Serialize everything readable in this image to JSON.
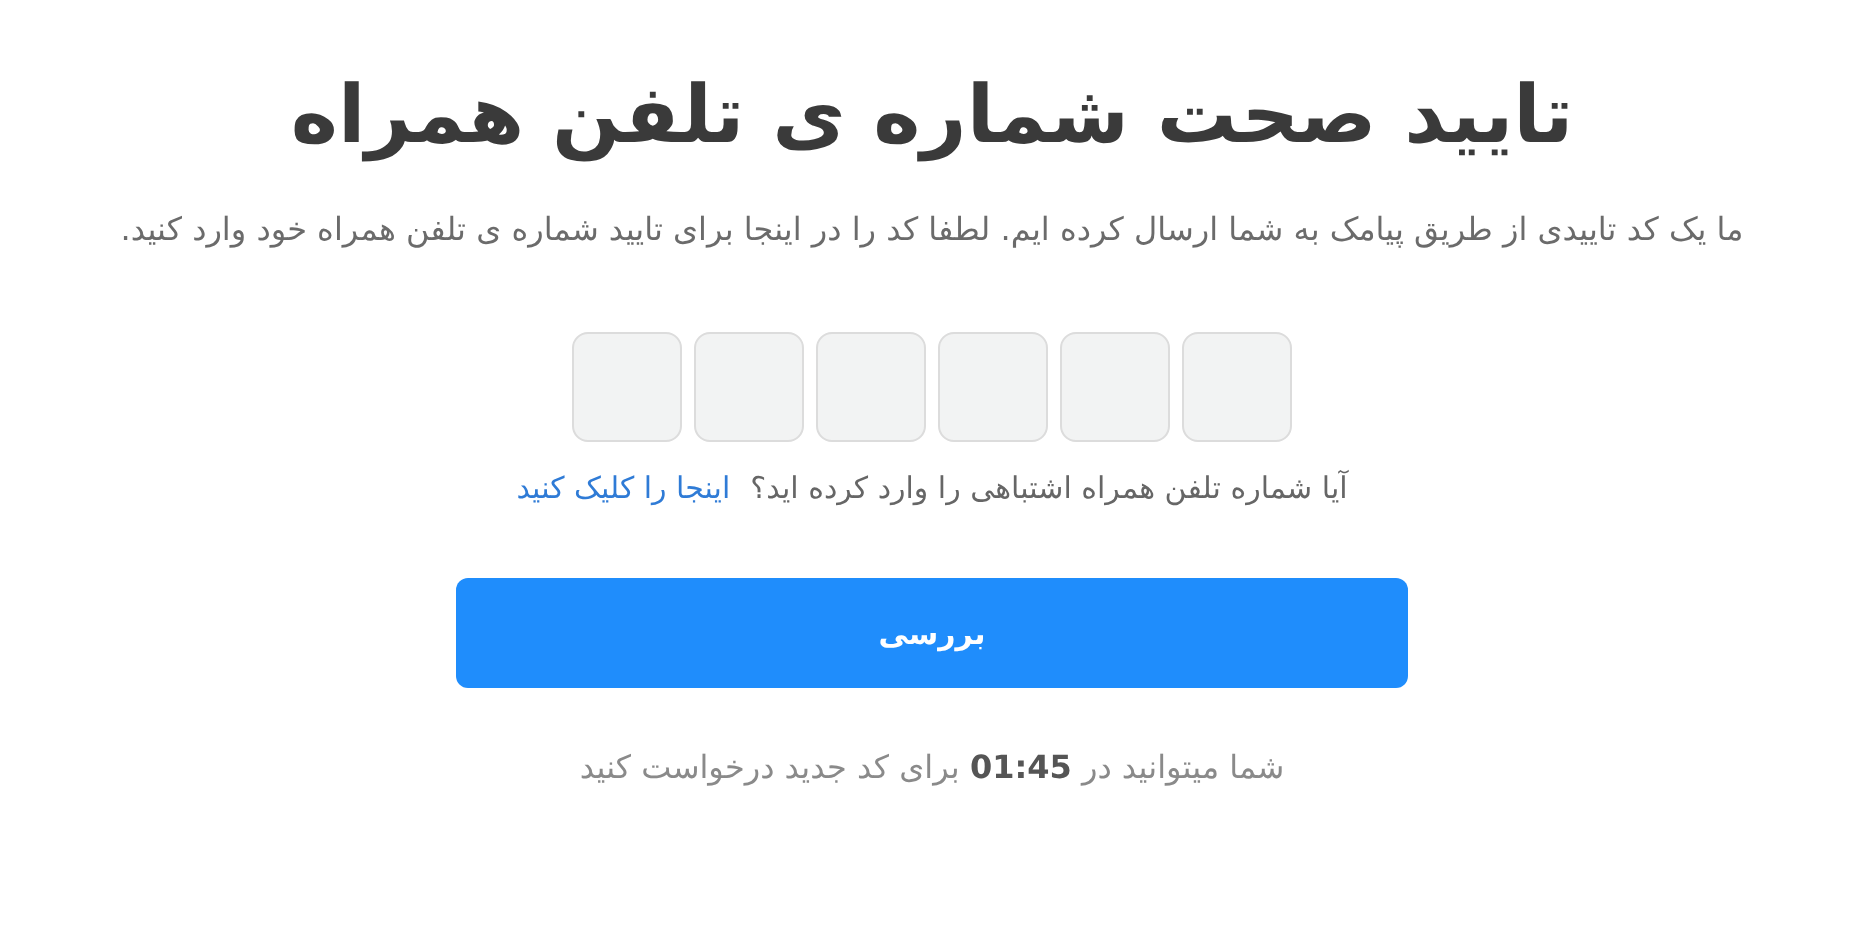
{
  "title": "تایید صحت شماره ی تلفن همراه",
  "description": "ما یک کد تاییدی از طریق پیامک به شما ارسال کرده ایم. لطفا کد را در اینجا برای تایید شماره ی تلفن همراه خود وارد کنید.",
  "code_inputs": [
    {
      "kind": "digit"
    },
    {
      "kind": "digit"
    },
    {
      "kind": "digit"
    },
    {
      "kind": "digit"
    },
    {
      "kind": "digit"
    },
    {
      "kind": "digit"
    }
  ],
  "wrong_number": {
    "question": "آیا شماره تلفن همراه اشتباهی را وارد کرده اید؟",
    "link": "اینجا را کلیک کنید"
  },
  "submit_button": "بررسی",
  "resend_note": "شما میتوانید در  **01:45** برای کد جدید درخواست کنید"
}
